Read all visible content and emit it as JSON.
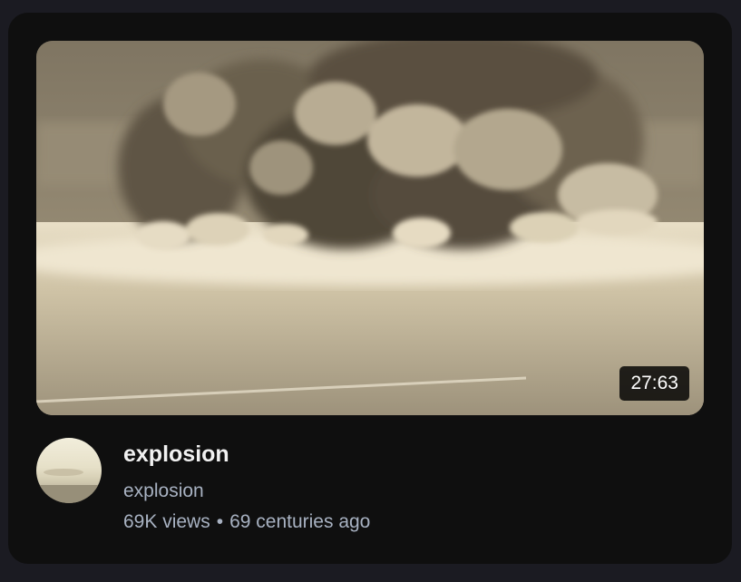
{
  "video": {
    "title": "explosion",
    "duration": "27:63",
    "thumbnail_icon": "explosion-thumbnail",
    "channel": {
      "name": "explosion",
      "avatar_icon": "channel-avatar"
    },
    "views": "69K views",
    "separator": "•",
    "age": "69 centuries ago"
  },
  "colors": {
    "background": "#1b1b22",
    "card": "#0f0f0f",
    "title": "#f1f1f1",
    "secondary_text": "#a8b2c2",
    "sepia_tone": "#d8ccb0"
  }
}
